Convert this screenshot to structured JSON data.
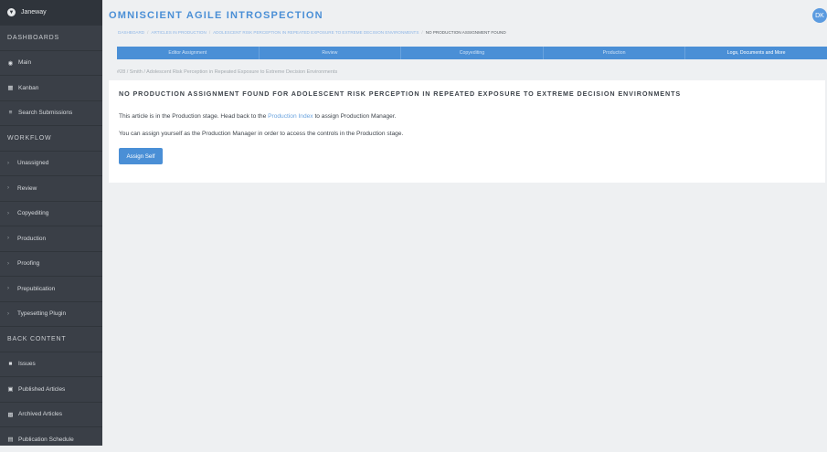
{
  "sidebar": {
    "brand": "Janeway",
    "sections": {
      "dashboards": "DASHBOARDS",
      "workflow": "WORKFLOW",
      "back_content": "BACK CONTENT"
    },
    "dashboard_items": [
      {
        "label": "Main",
        "icon": "tachometer-icon"
      },
      {
        "label": "Kanban",
        "icon": "kanban-icon"
      },
      {
        "label": "Search Submissions",
        "icon": "list-icon"
      }
    ],
    "workflow_items": [
      {
        "label": "Unassigned"
      },
      {
        "label": "Review"
      },
      {
        "label": "Copyediting"
      },
      {
        "label": "Production"
      },
      {
        "label": "Proofing"
      },
      {
        "label": "Prepublication"
      },
      {
        "label": "Typesetting Plugin"
      }
    ],
    "back_content_items": [
      {
        "label": "Issues",
        "icon": "folder-icon"
      },
      {
        "label": "Published Articles",
        "icon": "file-icon"
      },
      {
        "label": "Archived Articles",
        "icon": "archive-icon"
      },
      {
        "label": "Publication Schedule",
        "icon": "calendar-icon"
      }
    ]
  },
  "header": {
    "title": "OMNISCIENT AGILE INTROSPECTION",
    "avatar": "DK"
  },
  "breadcrumb": {
    "items": [
      "DASHBOARD",
      "ARTICLES IN PRODUCTION",
      "ADOLESCENT RISK PERCEPTION IN REPEATED EXPOSURE TO EXTREME DECISION ENVIRONMENTS"
    ],
    "current": "NO PRODUCTION ASSIGNMENT FOUND"
  },
  "tabs": [
    {
      "label": "Editor Assignment"
    },
    {
      "label": "Review"
    },
    {
      "label": "Copyediting"
    },
    {
      "label": "Production"
    },
    {
      "label": "Logs, Documents and More"
    }
  ],
  "subhead": "#28 / Smith / Adolescent Risk Perception in Repeated Exposure to Extreme Decision Environments",
  "card": {
    "title": "NO PRODUCTION ASSIGNMENT FOUND FOR ADOLESCENT RISK PERCEPTION IN REPEATED EXPOSURE TO EXTREME DECISION ENVIRONMENTS",
    "line1_before": "This article is in the Production stage. Head back to the ",
    "line1_link": "Production Index",
    "line1_after": " to assign Production Manager.",
    "line2": "You can assign yourself as the Production Manager in order to access the controls in the Production stage.",
    "button": "Assign Self"
  },
  "colors": {
    "accent": "#4a8fd6",
    "sidebar_bg": "#3a3f47",
    "page_bg": "#eef0f2"
  }
}
